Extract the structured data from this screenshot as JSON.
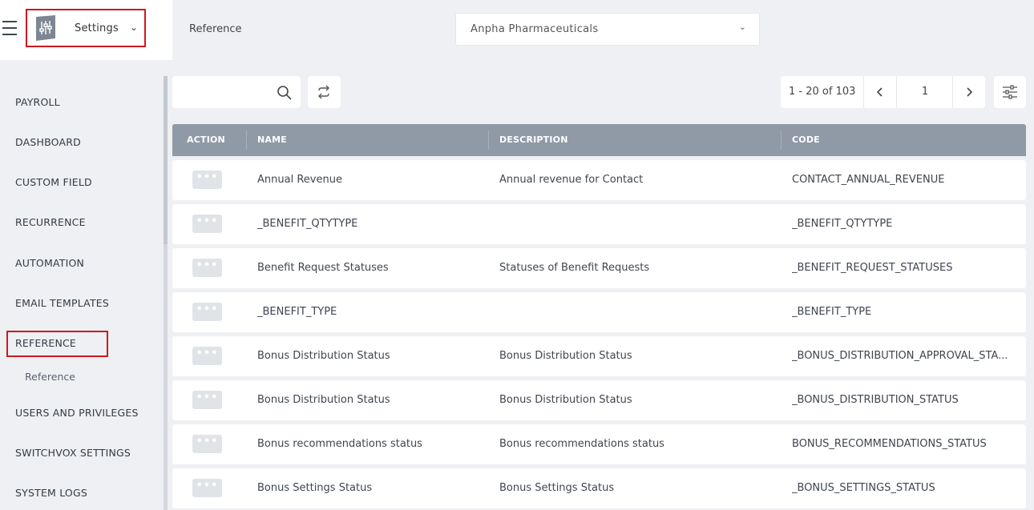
{
  "header": {
    "app_name": "Settings",
    "breadcrumb": "Reference",
    "company": "Anpha Pharmaceuticals"
  },
  "sidebar": {
    "items": [
      {
        "label": "PAYROLL"
      },
      {
        "label": "DASHBOARD"
      },
      {
        "label": "CUSTOM FIELD"
      },
      {
        "label": "RECURRENCE"
      },
      {
        "label": "AUTOMATION"
      },
      {
        "label": "EMAIL TEMPLATES"
      },
      {
        "label": "REFERENCE",
        "active": true
      },
      {
        "label": "USERS AND PRIVILEGES"
      },
      {
        "label": "SWITCHVOX SETTINGS"
      },
      {
        "label": "SYSTEM LOGS"
      }
    ],
    "subitem": "Reference"
  },
  "toolbar": {
    "search_value": "",
    "pagination": {
      "range": "1 - 20 of 103",
      "page": "1"
    }
  },
  "table": {
    "columns": [
      "ACTION",
      "NAME",
      "DESCRIPTION",
      "CODE"
    ],
    "action_label": "•••",
    "rows": [
      {
        "name": "Annual Revenue",
        "description": "Annual revenue for Contact",
        "code": "CONTACT_ANNUAL_REVENUE"
      },
      {
        "name": "_BENEFIT_QTYTYPE",
        "description": "",
        "code": "_BENEFIT_QTYTYPE"
      },
      {
        "name": "Benefit Request Statuses",
        "description": "Statuses of Benefit Requests",
        "code": "_BENEFIT_REQUEST_STATUSES"
      },
      {
        "name": "_BENEFIT_TYPE",
        "description": "",
        "code": "_BENEFIT_TYPE"
      },
      {
        "name": "Bonus Distribution Status",
        "description": "Bonus Distribution Status",
        "code": "_BONUS_DISTRIBUTION_APPROVAL_STA..."
      },
      {
        "name": "Bonus Distribution Status",
        "description": "Bonus Distribution Status",
        "code": "_BONUS_DISTRIBUTION_STATUS"
      },
      {
        "name": "Bonus recommendations status",
        "description": "Bonus recommendations status",
        "code": "BONUS_RECOMMENDATIONS_STATUS"
      },
      {
        "name": "Bonus Settings Status",
        "description": "Bonus Settings Status",
        "code": "_BONUS_SETTINGS_STATUS"
      }
    ]
  },
  "colors": {
    "highlight": "#d0181e",
    "table_header": "#8f9aa6",
    "background": "#eef0f3"
  }
}
